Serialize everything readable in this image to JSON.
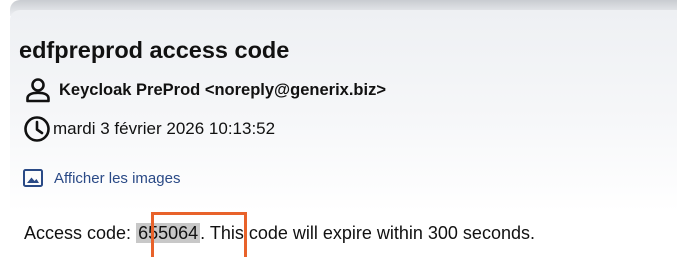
{
  "email": {
    "subject": "edfpreprod access code",
    "sender": "Keycloak PreProd <noreply@generix.biz>",
    "date": "mardi 3 février 2026 10:13:52",
    "show_images_label": "Afficher les images",
    "body": {
      "prefix": "Access code: ",
      "code": "655064",
      "suffix": ". This code will expire within 300 seconds."
    }
  },
  "icons": {
    "sender": "person-icon",
    "date": "clock-icon",
    "images": "image-icon"
  },
  "colors": {
    "highlight": "#e8622a",
    "link": "#2a4a86",
    "code_background": "#c8c8c8"
  }
}
